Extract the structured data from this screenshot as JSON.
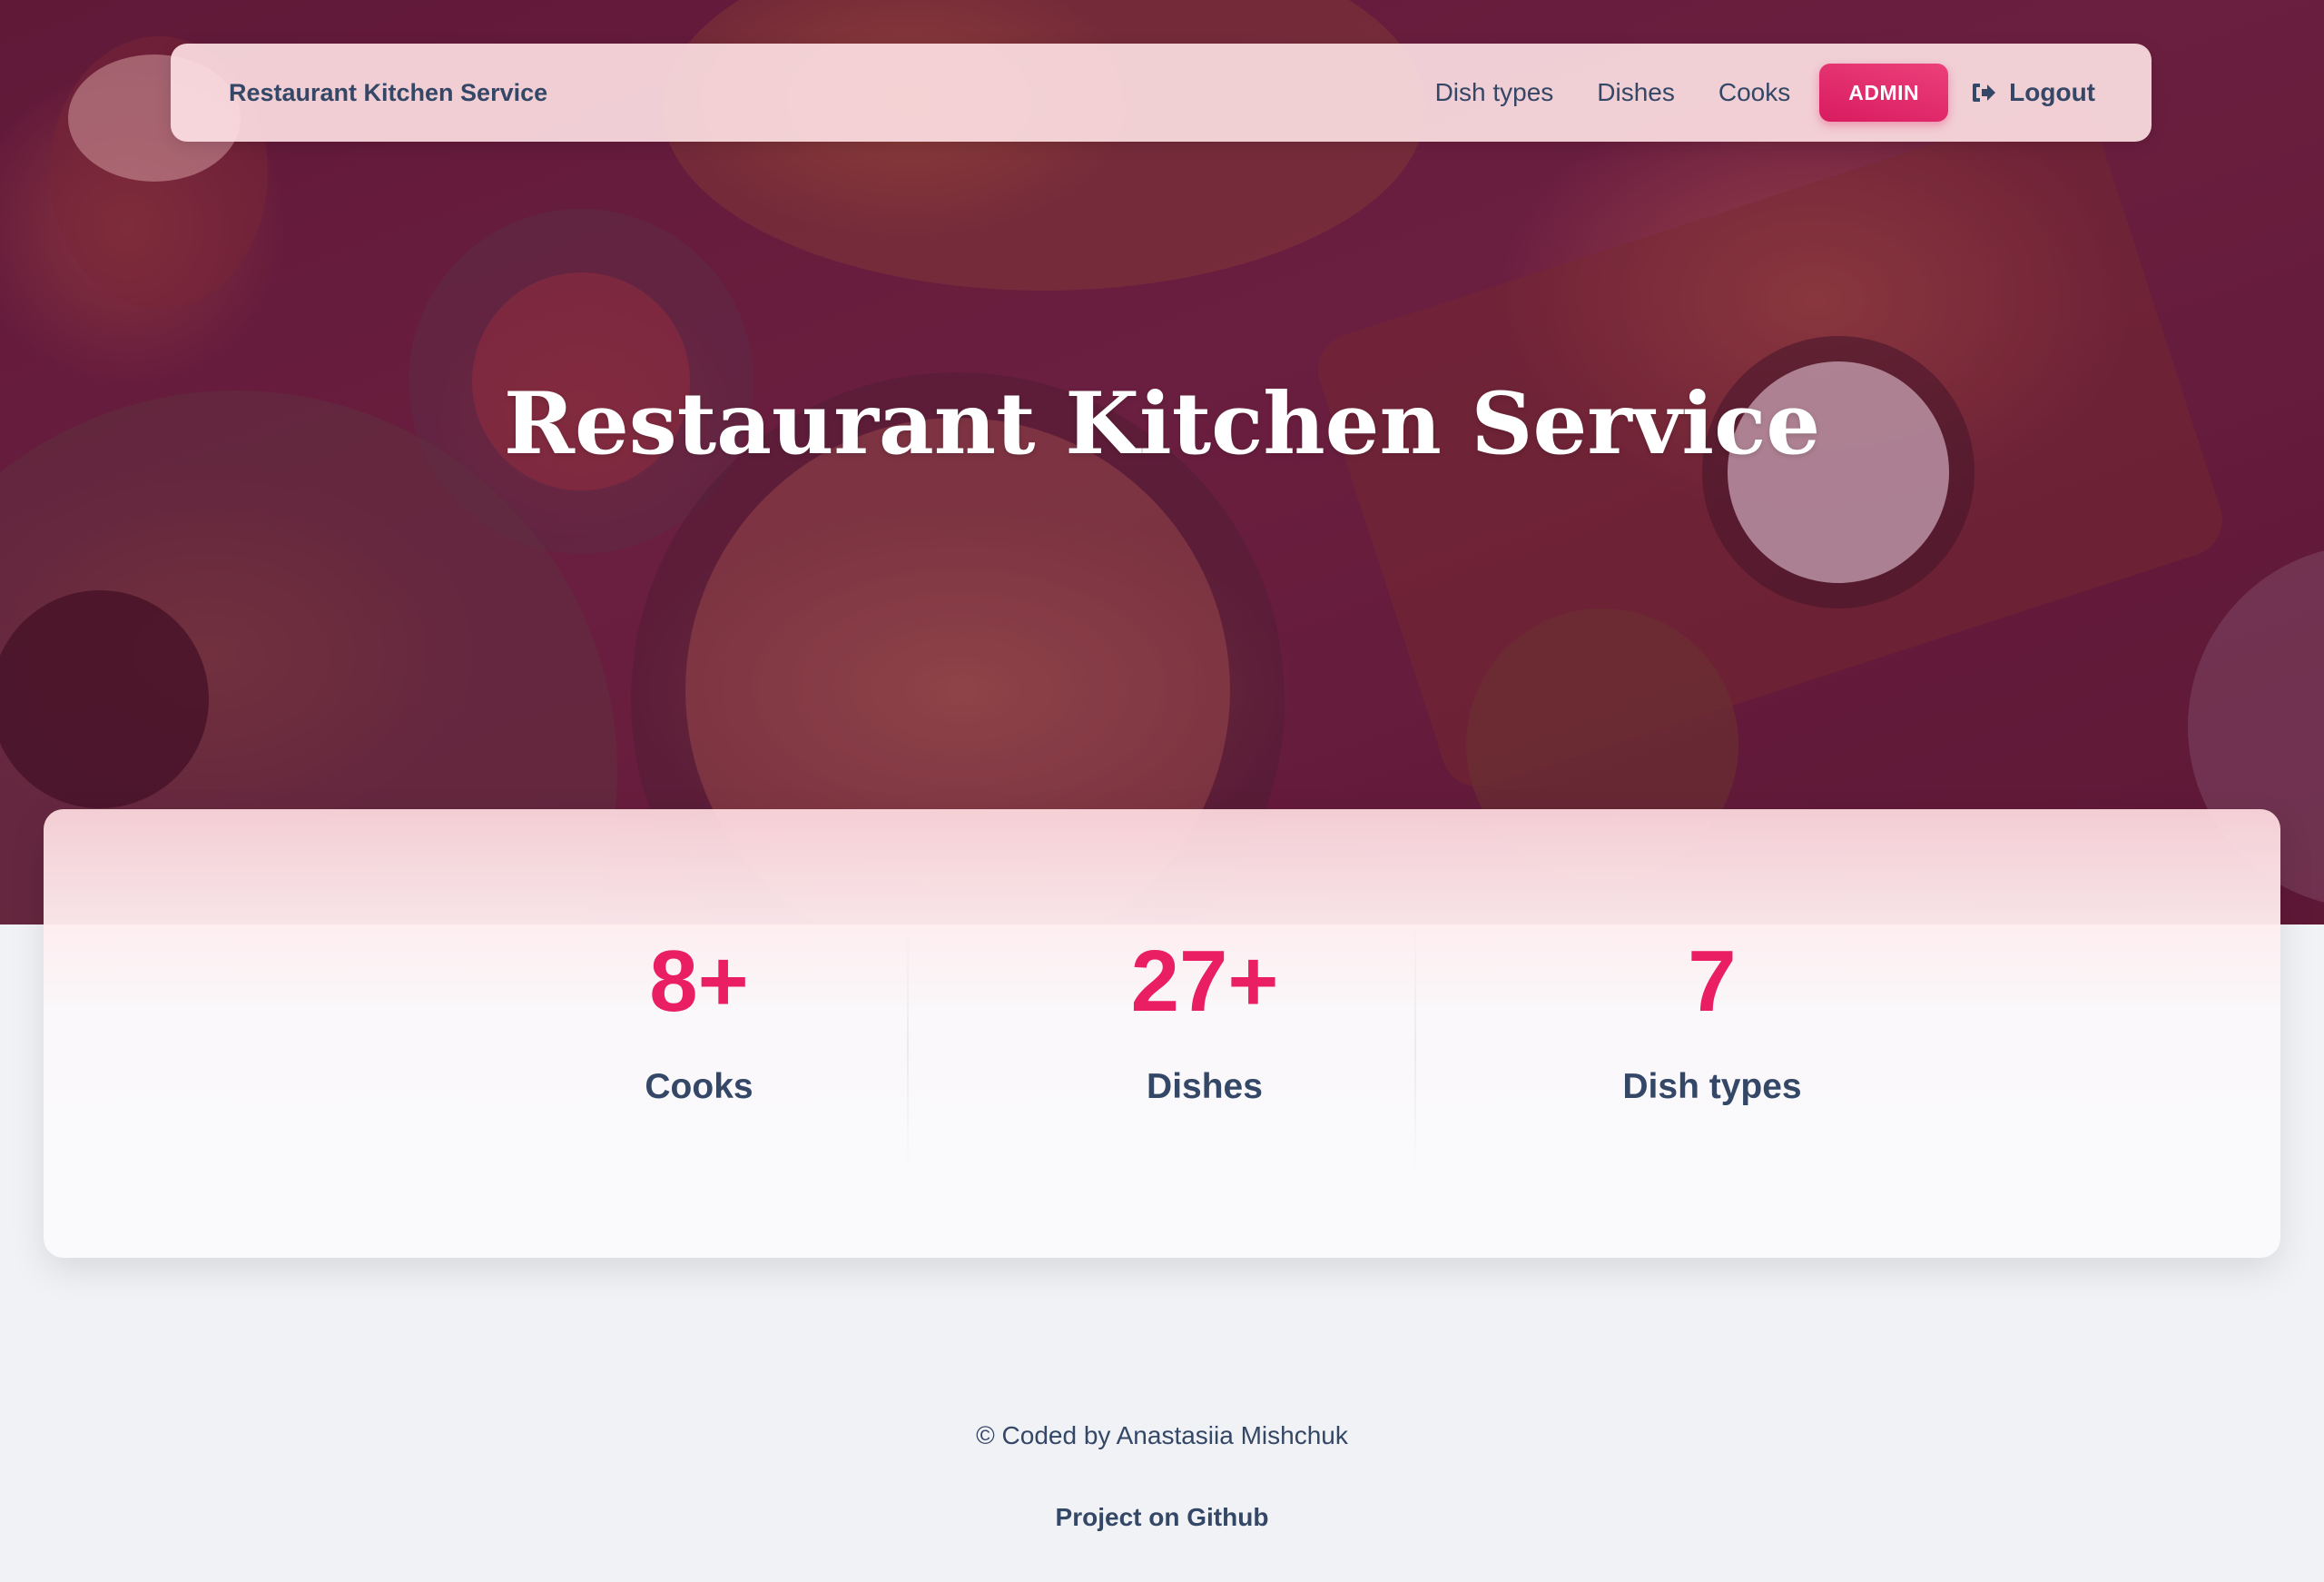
{
  "navbar": {
    "brand": "Restaurant Kitchen Service",
    "links": [
      "Dish types",
      "Dishes",
      "Cooks"
    ],
    "admin_label": "ADMIN",
    "logout_label": "Logout"
  },
  "hero": {
    "title": "Restaurant Kitchen Service"
  },
  "stats": [
    {
      "value": "8+",
      "label": "Cooks"
    },
    {
      "value": "27+",
      "label": "Dishes"
    },
    {
      "value": "7",
      "label": "Dish types"
    }
  ],
  "footer": {
    "copyright": "© Coded by Anastasiia Mishchuk",
    "link": "Project on Github"
  },
  "colors": {
    "accent": "#e91e63",
    "text": "#344767",
    "page_background": "#f0f2f5"
  },
  "icons": {
    "logout": "sign-out-icon"
  }
}
